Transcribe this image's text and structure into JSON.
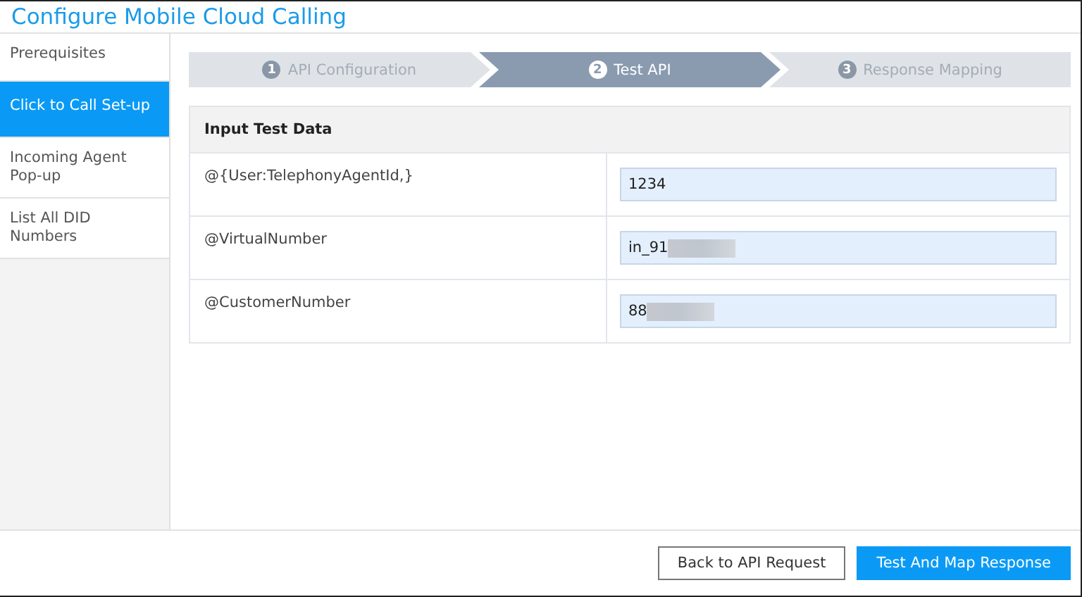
{
  "window": {
    "title": "Configure Mobile Cloud Calling"
  },
  "sidebar": {
    "items": [
      {
        "label": "Prerequisites",
        "selected": false
      },
      {
        "label": "Click to Call Set-up",
        "selected": true
      },
      {
        "label": "Incoming Agent Pop-up",
        "selected": false
      },
      {
        "label": "List All DID Numbers",
        "selected": false
      }
    ]
  },
  "steps": [
    {
      "number": "1",
      "label": "API Configuration",
      "selected": false
    },
    {
      "number": "2",
      "label": "Test API",
      "selected": true
    },
    {
      "number": "3",
      "label": "Response Mapping",
      "selected": false
    }
  ],
  "table": {
    "title": "Input Test Data",
    "rows": [
      {
        "name": "@{User:TelephonyAgentId,}",
        "value": "1234",
        "masked": false
      },
      {
        "name": "@VirtualNumber",
        "value": "in_91",
        "masked": true
      },
      {
        "name": "@CustomerNumber",
        "value": "88",
        "masked": true
      }
    ]
  },
  "buttons": [
    {
      "label": "Back to API Request",
      "kind": "secondary"
    },
    {
      "label": "Test And Map Response",
      "kind": "primary"
    }
  ]
}
